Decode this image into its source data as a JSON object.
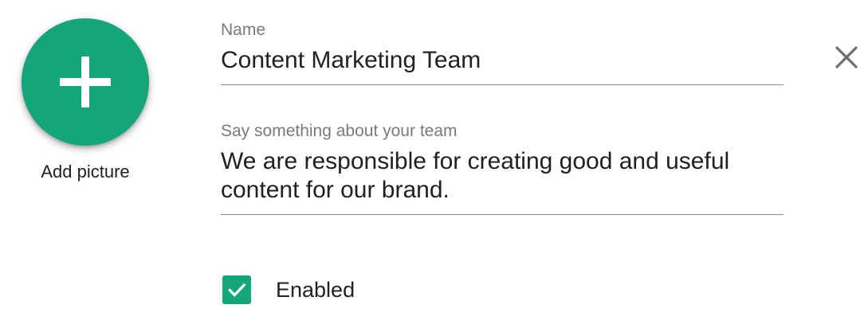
{
  "avatar": {
    "button_icon": "plus-icon",
    "label": "Add picture",
    "color": "#14a67a"
  },
  "name_field": {
    "label": "Name",
    "value": "Content Marketing Team"
  },
  "description_field": {
    "label": "Say something about your team",
    "value": "We are responsible for creating good and useful\ncontent for our brand."
  },
  "enabled_checkbox": {
    "label": "Enabled",
    "checked": true,
    "icon": "check-icon"
  },
  "close": {
    "icon": "close-icon"
  }
}
